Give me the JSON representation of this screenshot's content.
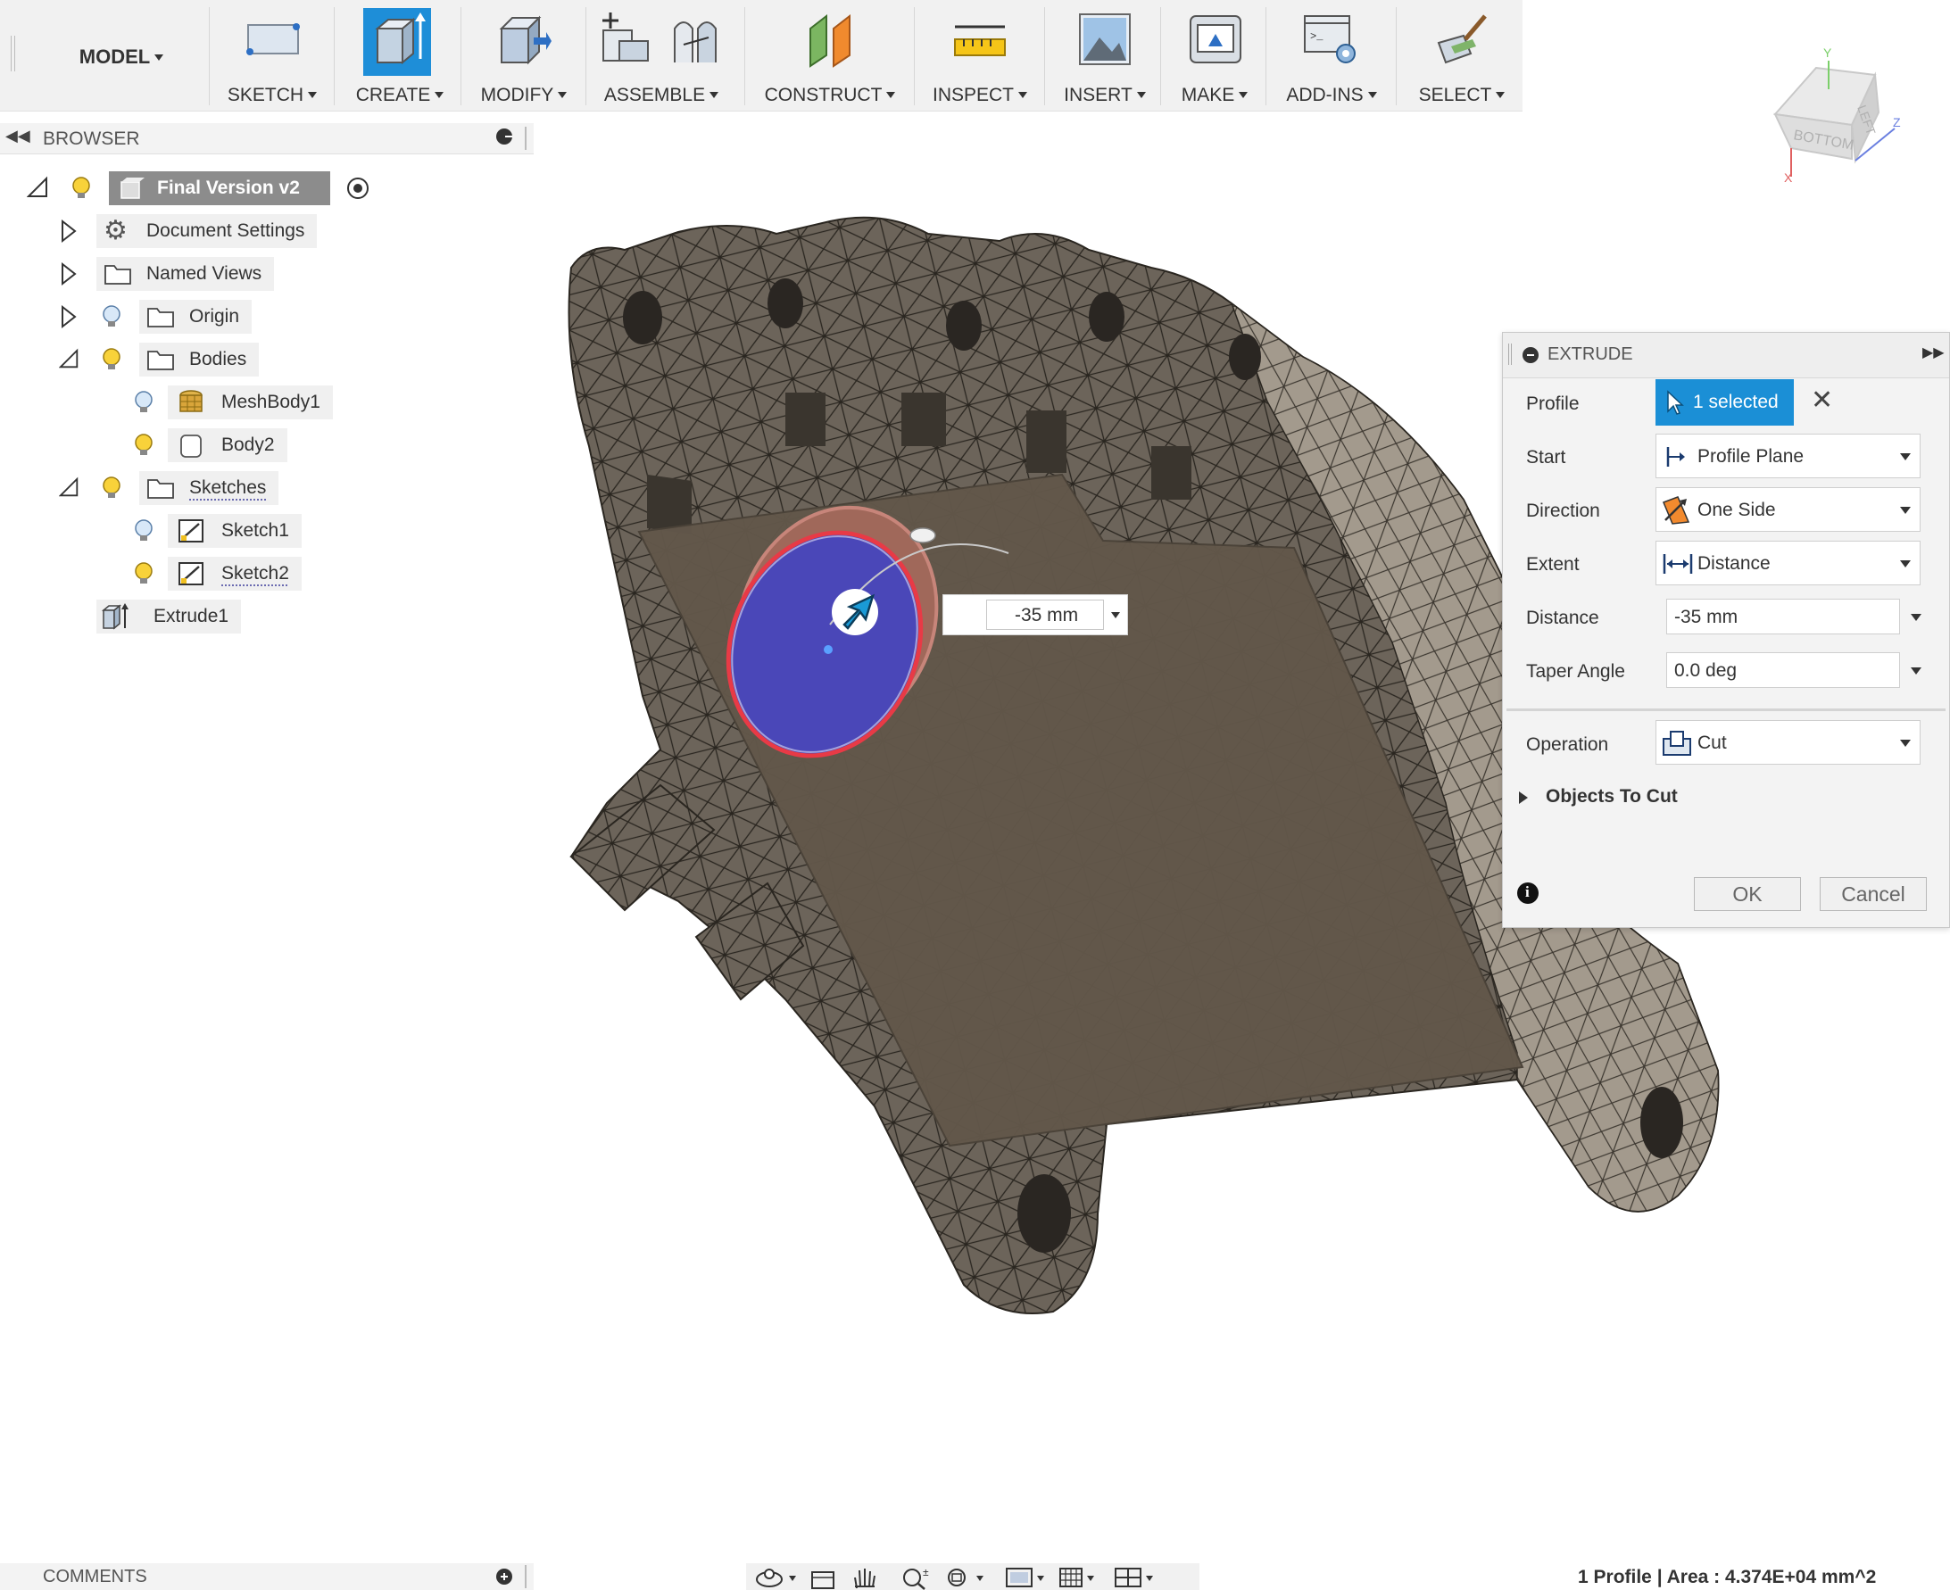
{
  "toolbar": {
    "workspace": "MODEL",
    "groups": [
      {
        "label": "SKETCH",
        "icon": "sketch-icon"
      },
      {
        "label": "CREATE",
        "icon": "extrude-icon"
      },
      {
        "label": "MODIFY",
        "icon": "press-pull-icon"
      },
      {
        "label": "ASSEMBLE",
        "icon": "assemble-icon"
      },
      {
        "label": "CONSTRUCT",
        "icon": "construct-plane-icon"
      },
      {
        "label": "INSPECT",
        "icon": "measure-ruler-icon"
      },
      {
        "label": "INSERT",
        "icon": "insert-image-icon"
      },
      {
        "label": "MAKE",
        "icon": "3d-print-icon"
      },
      {
        "label": "ADD-INS",
        "icon": "scripts-addins-icon"
      },
      {
        "label": "SELECT",
        "icon": "select-brush-icon"
      }
    ]
  },
  "viewcube": {
    "face_bottom": "BOTTOM",
    "face_left": "LEFT",
    "axis_x": "X",
    "axis_y": "Y",
    "axis_z": "Z"
  },
  "browser": {
    "title": "BROWSER",
    "root": "Final Version v2",
    "items": [
      {
        "label": "Document Settings",
        "icon": "gear-icon"
      },
      {
        "label": "Named Views",
        "icon": "folder-icon"
      },
      {
        "label": "Origin",
        "icon": "folder-icon"
      },
      {
        "label": "Bodies",
        "icon": "folder-icon"
      },
      {
        "label": "MeshBody1",
        "icon": "mesh-body-icon"
      },
      {
        "label": "Body2",
        "icon": "solid-body-icon"
      },
      {
        "label": "Sketches",
        "icon": "folder-icon"
      },
      {
        "label": "Sketch1",
        "icon": "sketch-icon"
      },
      {
        "label": "Sketch2",
        "icon": "sketch-icon"
      },
      {
        "label": "Extrude1",
        "icon": "extrude-feature-icon"
      }
    ]
  },
  "extrude": {
    "title": "EXTRUDE",
    "profile_label": "Profile",
    "profile_value": "1 selected",
    "start_label": "Start",
    "start_value": "Profile Plane",
    "direction_label": "Direction",
    "direction_value": "One Side",
    "extent_label": "Extent",
    "extent_value": "Distance",
    "distance_label": "Distance",
    "distance_value": "-35 mm",
    "taper_label": "Taper Angle",
    "taper_value": "0.0 deg",
    "operation_label": "Operation",
    "operation_value": "Cut",
    "objects_label": "Objects To Cut",
    "ok": "OK",
    "cancel": "Cancel"
  },
  "canvas": {
    "distance_input": "-35 mm"
  },
  "bottom": {
    "comments": "COMMENTS",
    "status": "1 Profile | Area : 4.374E+04 mm^2"
  },
  "colors": {
    "accent": "#0696d7",
    "mesh_fill": "#6f675c",
    "plane_fill": "#62574a",
    "profile_fill": "#4a47b8"
  }
}
